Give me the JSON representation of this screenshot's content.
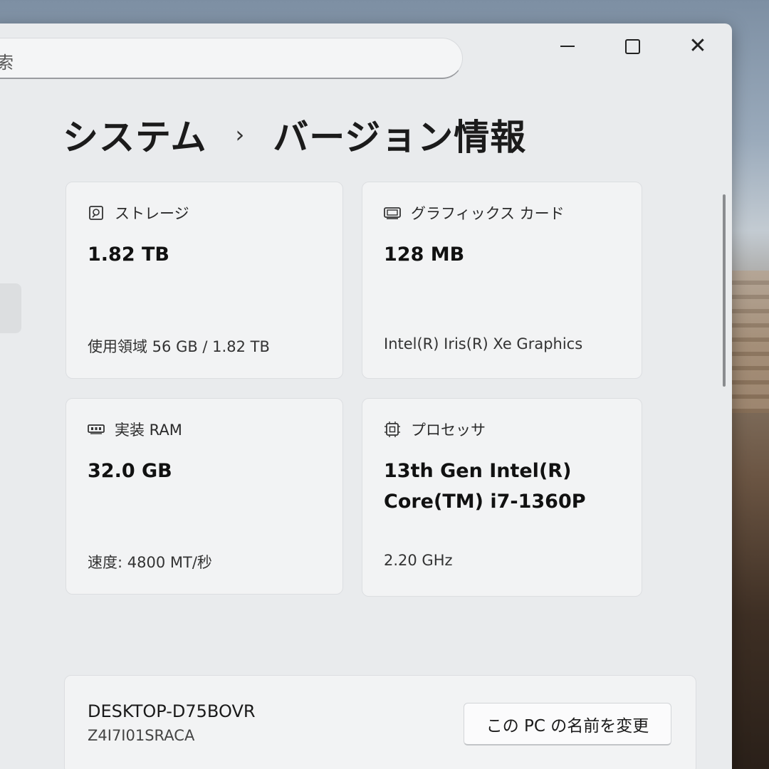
{
  "search": {
    "placeholder": "検索"
  },
  "window_controls": {
    "minimize_icon": "minimize-icon",
    "maximize_icon": "maximize-icon",
    "close_icon": "close-icon"
  },
  "breadcrumb": {
    "parent": "システム",
    "separator": "›",
    "current": "バージョン情報"
  },
  "cards": {
    "storage": {
      "icon": "storage-icon",
      "label": "ストレージ",
      "value": "1.82 TB",
      "sub": "使用領域 56 GB / 1.82 TB"
    },
    "graphics": {
      "icon": "graphics-card-icon",
      "label": "グラフィックス カード",
      "value": "128 MB",
      "sub": "Intel(R) Iris(R) Xe Graphics"
    },
    "ram": {
      "icon": "ram-icon",
      "label": "実装 RAM",
      "value": "32.0 GB",
      "sub": "速度: 4800 MT/秒"
    },
    "processor": {
      "icon": "processor-icon",
      "label": "プロセッサ",
      "value_line1": "13th Gen Intel(R)",
      "value_line2": "Core(TM) i7-1360P",
      "sub": "2.20 GHz"
    }
  },
  "pc": {
    "name": "DESKTOP-D75BOVR",
    "model": "Z4I7I01SRACA",
    "rename_button": "この PC の名前を変更"
  }
}
